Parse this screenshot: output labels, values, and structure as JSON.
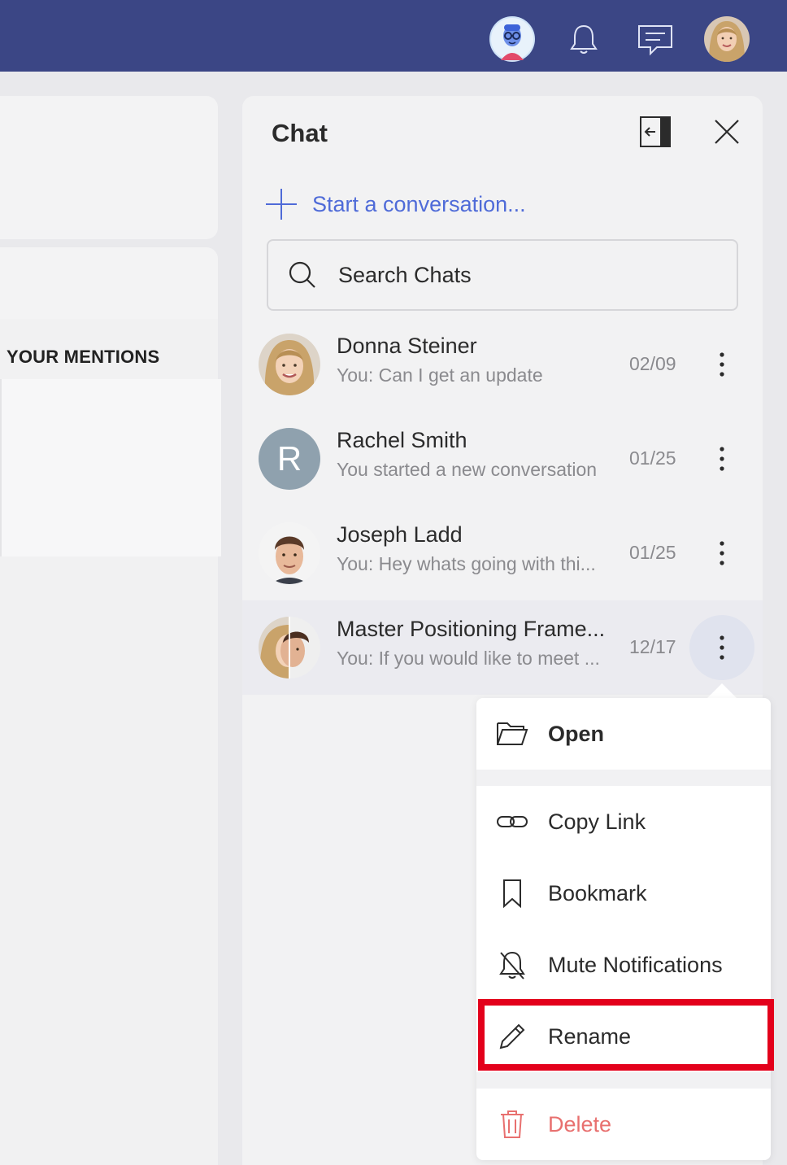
{
  "header": {
    "icons": [
      "assistant-avatar",
      "bell-icon",
      "chat-icon",
      "user-avatar"
    ]
  },
  "left": {
    "section_title": "YOUR MENTIONS"
  },
  "chat_panel": {
    "title": "Chat",
    "start_conversation": "Start a conversation...",
    "search_placeholder": "Search Chats",
    "conversations": [
      {
        "name": "Donna Steiner",
        "preview": "You: Can I get an update",
        "date": "02/09"
      },
      {
        "name": "Rachel Smith",
        "preview": "You started a new conversation",
        "date": "01/25",
        "initial": "R"
      },
      {
        "name": "Joseph Ladd",
        "preview": "You: Hey whats going with thi...",
        "date": "01/25"
      },
      {
        "name": "Master Positioning Frame...",
        "preview": "You: If you would like to meet ...",
        "date": "12/17"
      }
    ]
  },
  "context_menu": {
    "items": [
      {
        "label": "Open",
        "icon": "folder-icon"
      },
      {
        "label": "Copy Link",
        "icon": "link-icon"
      },
      {
        "label": "Bookmark",
        "icon": "bookmark-icon"
      },
      {
        "label": "Mute Notifications",
        "icon": "bell-off-icon"
      },
      {
        "label": "Rename",
        "icon": "pencil-icon"
      },
      {
        "label": "Delete",
        "icon": "trash-icon"
      }
    ]
  },
  "colors": {
    "topbar": "#3b4685",
    "accent": "#4f6bd8",
    "delete": "#e8706f",
    "highlight": "#e3001b"
  }
}
